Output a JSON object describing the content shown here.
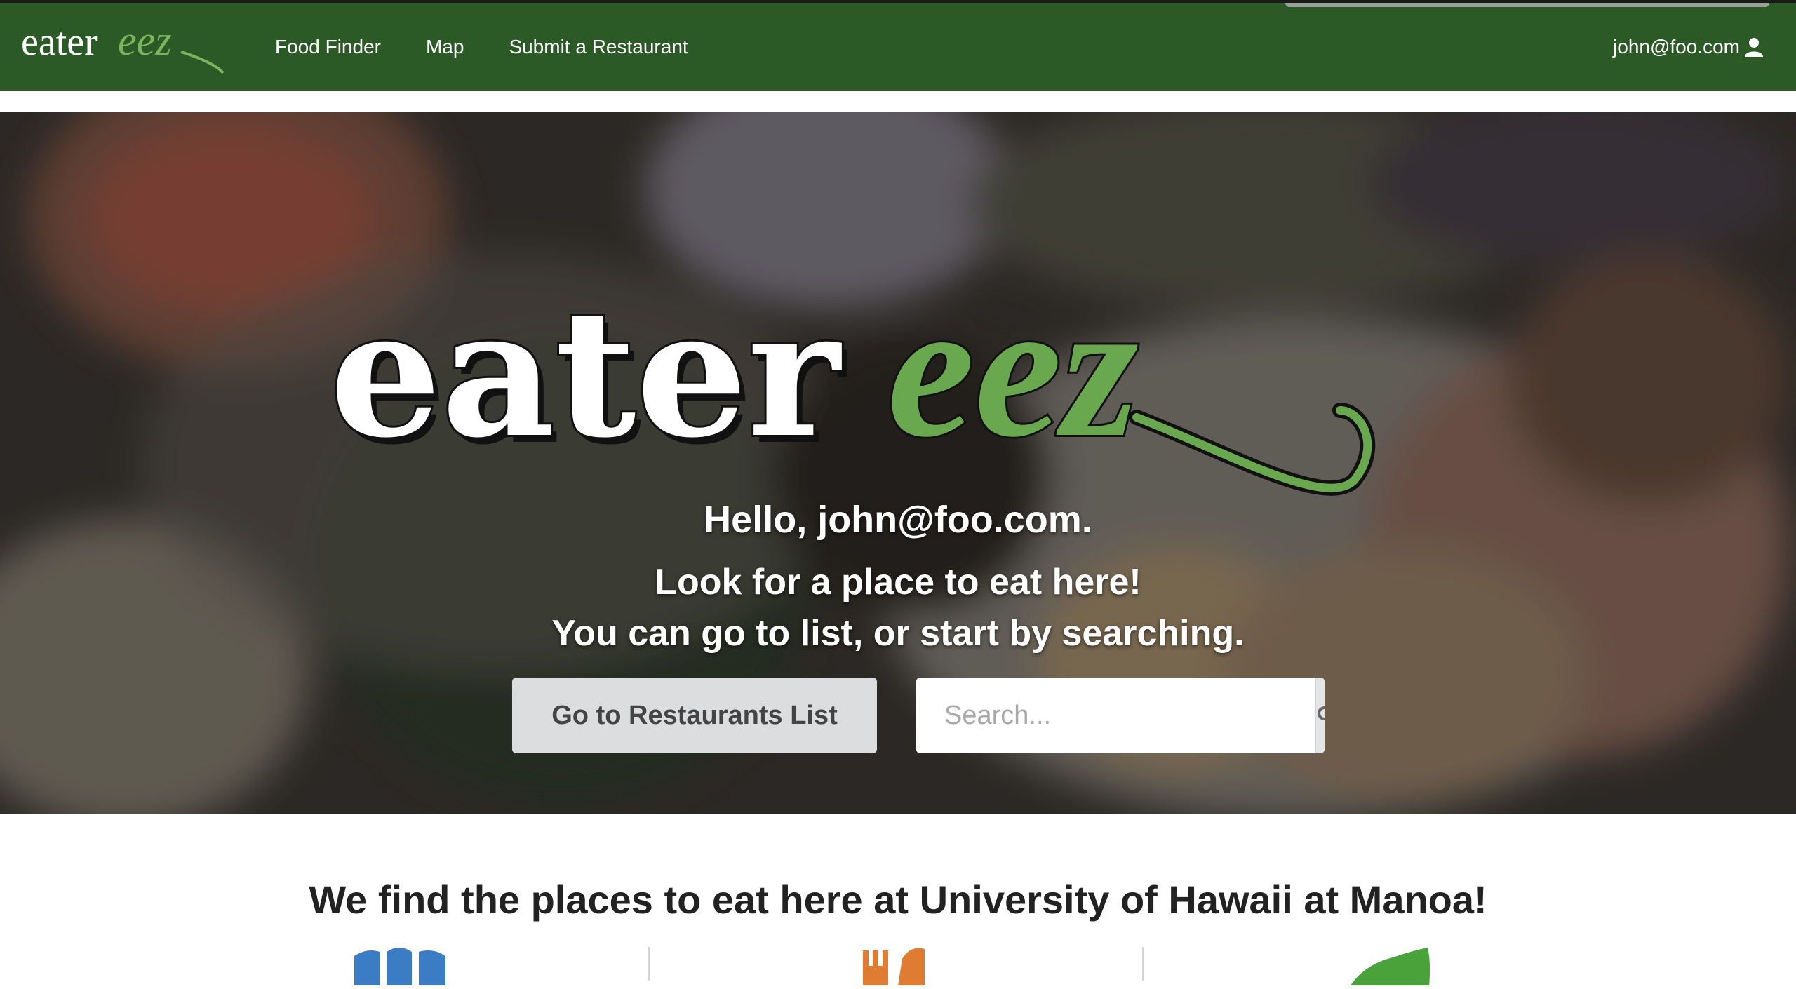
{
  "brand": {
    "part1": "eater",
    "part2": "eez"
  },
  "nav": {
    "links": [
      "Food Finder",
      "Map",
      "Submit a Restaurant"
    ],
    "user": "john@foo.com"
  },
  "hero": {
    "greeting": "Hello, john@foo.com.",
    "line1": "Look for a place to eat here!",
    "line2": "You can go to list, or start by searching.",
    "list_button": "Go to Restaurants List",
    "search_placeholder": "Search..."
  },
  "tagline": "We find the places to eat here at University of Hawaii at Manoa!",
  "features": [
    {
      "icon": "book-icon",
      "color": "#3b7dc4"
    },
    {
      "icon": "utensils-icon",
      "color": "#e07b32"
    },
    {
      "icon": "leaf-icon",
      "color": "#49a33a"
    }
  ],
  "colors": {
    "nav": "#2c5a27",
    "accent_green": "#6aa84f"
  }
}
